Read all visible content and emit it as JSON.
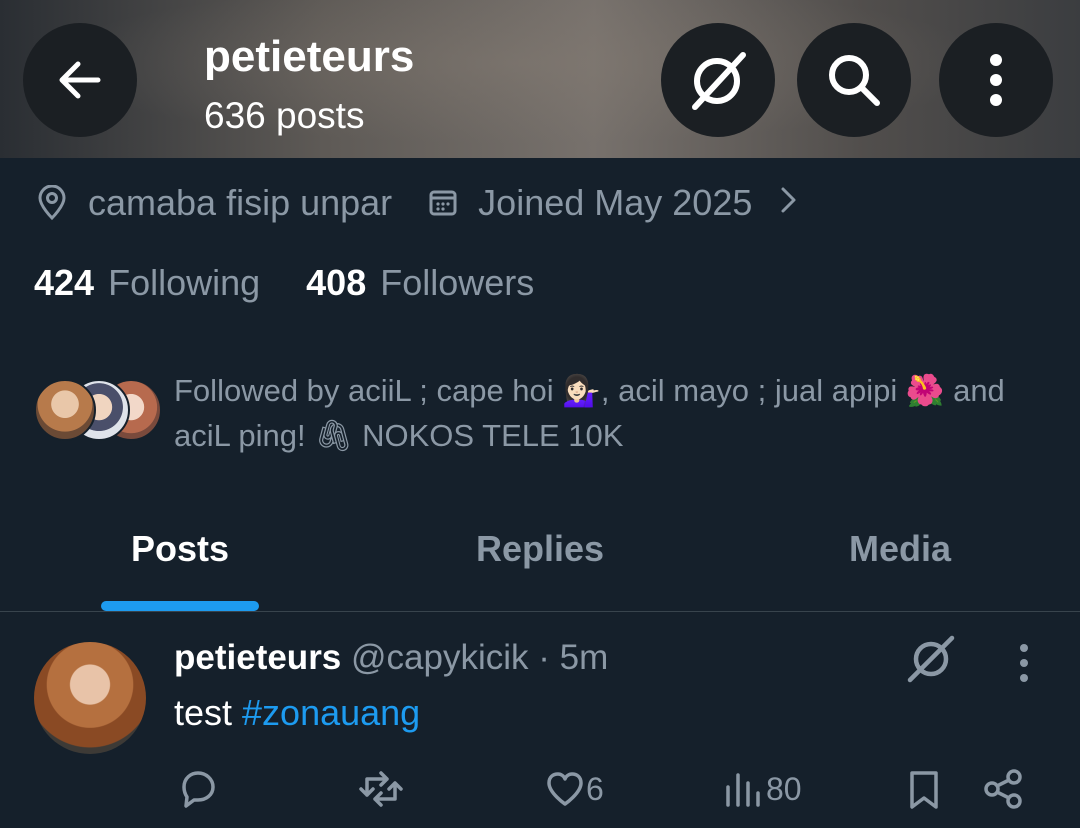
{
  "header": {
    "name": "petieteurs",
    "post_count": "636 posts",
    "icons": [
      "back-arrow-icon",
      "grok-icon",
      "search-icon",
      "more-vertical-icon"
    ]
  },
  "profile": {
    "location": "camaba fisip unpar",
    "joined": "Joined May 2025",
    "following_count": "424",
    "following_label": "Following",
    "followers_count": "408",
    "followers_label": "Followers",
    "followed_by": "Followed by aciiL ; cape hoi 💁🏻‍♀️, acil mayo ; jual apipi 🌺 and aciL ping! 🖇 NOKOS TELE 10K"
  },
  "tabs": [
    {
      "label": "Posts",
      "active": true
    },
    {
      "label": "Replies",
      "active": false
    },
    {
      "label": "Media",
      "active": false
    }
  ],
  "post": {
    "display_name": "petieteurs",
    "handle": "@capykicik",
    "time": "· 5m",
    "text": "test ",
    "hashtag": "#zonauang",
    "likes": "6",
    "views": "80"
  },
  "colors": {
    "background": "#15202b",
    "accent": "#1d9bf0",
    "muted": "#8b98a5"
  }
}
